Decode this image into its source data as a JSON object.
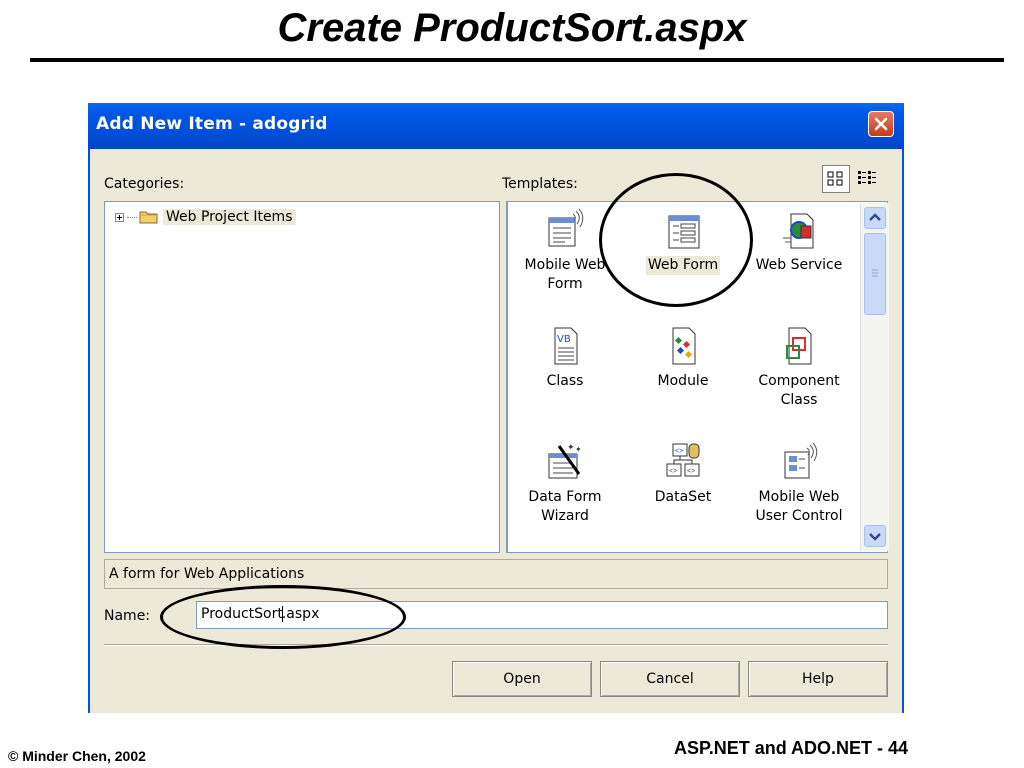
{
  "slide": {
    "title": "Create ProductSort.aspx",
    "footer_left": "© Minder Chen, 2002",
    "footer_right": "ASP.NET and ADO.NET - 44"
  },
  "dialog": {
    "title": "Add New Item - adogrid",
    "categories_label": "Categories:",
    "templates_label": "Templates:",
    "tree": [
      {
        "label": "Web Project Items",
        "icon": "folder-icon",
        "expanded": false
      }
    ],
    "templates": [
      {
        "line1": "Mobile Web",
        "line2": "Form",
        "icon": "mobile-web-form-icon"
      },
      {
        "line1": "Web Form",
        "line2": "",
        "icon": "web-form-icon",
        "selected": true
      },
      {
        "line1": "Web Service",
        "line2": "",
        "icon": "web-service-icon"
      },
      {
        "line1": "Class",
        "line2": "",
        "icon": "class-icon"
      },
      {
        "line1": "Module",
        "line2": "",
        "icon": "module-icon"
      },
      {
        "line1": "Component",
        "line2": "Class",
        "icon": "component-class-icon"
      },
      {
        "line1": "Data Form",
        "line2": "Wizard",
        "icon": "data-form-wizard-icon"
      },
      {
        "line1": "DataSet",
        "line2": "",
        "icon": "dataset-icon"
      },
      {
        "line1": "Mobile Web",
        "line2": "User Control",
        "icon": "mobile-web-user-control-icon"
      }
    ],
    "description": "A form for Web Applications",
    "name_label": "Name:",
    "name_value_before_caret": "ProductSort",
    "name_value_after_caret": ".aspx",
    "buttons": {
      "open": "Open",
      "cancel": "Cancel",
      "help": "Help"
    }
  },
  "colors": {
    "titlebar": "#0058e6",
    "dialog_bg": "#ece9d8",
    "close_button": "#d8573a"
  }
}
